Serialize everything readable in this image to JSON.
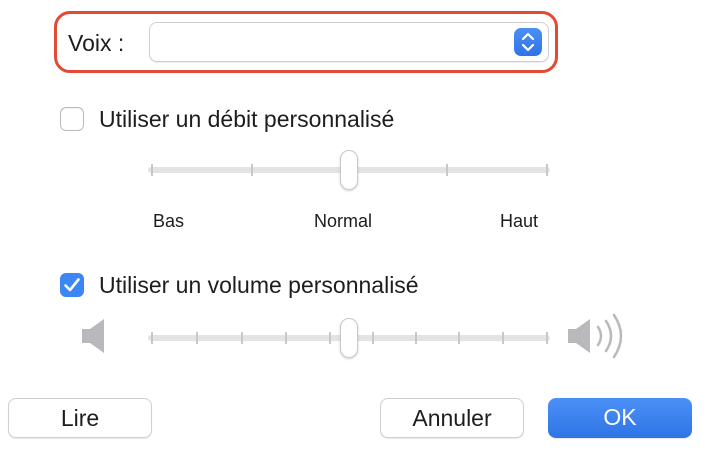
{
  "voice": {
    "label": "Voix :",
    "selected_value": ""
  },
  "rate": {
    "checkbox_label": "Utiliser un débit personnalisé",
    "checked": false,
    "labels": [
      "Bas",
      "Normal",
      "Haut"
    ],
    "level": 0.5
  },
  "volume": {
    "checkbox_label": "Utiliser un volume personnalisé",
    "checked": true,
    "level": 0.5
  },
  "buttons": {
    "play": "Lire",
    "cancel": "Annuler",
    "ok": "OK"
  },
  "colors": {
    "highlight": "#e34a33",
    "accent": "#3d86f5"
  },
  "icons": {
    "select": "up-down-chevron-icon",
    "check": "checkmark-icon",
    "volume_low": "speaker-low-icon",
    "volume_high": "speaker-high-icon"
  }
}
